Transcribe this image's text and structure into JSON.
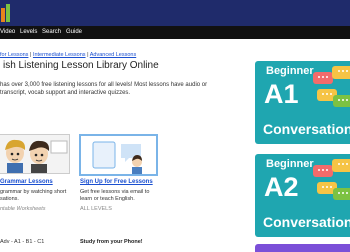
{
  "nav": {
    "items": [
      "Video",
      "Levels",
      "Search",
      "Guide"
    ]
  },
  "breadcrumbs": {
    "items": [
      "for Lessons",
      "Intermediate Lessons",
      "Advanced Lessons"
    ],
    "separator": "|"
  },
  "page": {
    "title": "ish Listening Lesson Library Online",
    "intro_line1": "has over 3,000 free listening lessons for all levels! Most lessons have audio or",
    "intro_line2": "transcript, vocab support and interactive quizzes."
  },
  "card_grammar": {
    "link": "Grammar Lessons",
    "desc_line1": "grammar by watching short",
    "desc_line2": "sations.",
    "note": "ntable Worksheets",
    "levels": "Adv - A1 - B1 - C1"
  },
  "card_signup": {
    "link": "Sign Up for Free Lessons",
    "desc_line1": "Get free lessons via email to",
    "desc_line2": "learn or teach English.",
    "levels_label": "ALL LEVELS",
    "cta": "Study from your Phone!"
  },
  "promos": [
    {
      "label": "Beginner",
      "level": "A1",
      "subtitle": "Conversation"
    },
    {
      "label": "Beginner",
      "level": "A2",
      "subtitle": "Conversation"
    }
  ],
  "colors": {
    "header_bg": "#1f2b6b",
    "nav_bg": "#111111",
    "link": "#1a4fd0",
    "promo_bg": "#1fa6b0",
    "promo_strip": "#7b4fd8"
  }
}
